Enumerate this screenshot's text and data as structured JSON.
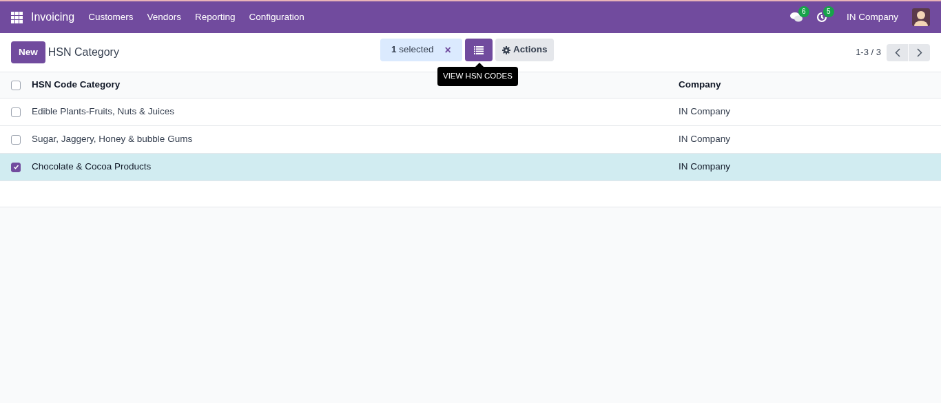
{
  "navbar": {
    "app_name": "Invoicing",
    "menu": [
      "Customers",
      "Vendors",
      "Reporting",
      "Configuration"
    ],
    "messages_count": "6",
    "activities_count": "5",
    "company": "IN Company"
  },
  "control_panel": {
    "new_button": "New",
    "title": "HSN Category",
    "selection": "**1** selected",
    "clear": "×",
    "tooltip": "VIEW HSN CODES",
    "actions": "Actions",
    "pager": "1-3 / 3"
  },
  "table": {
    "columns": [
      "HSN Code Category",
      "Company"
    ],
    "all_checked": false,
    "rows": [
      {
        "category": "Edible Plants-Fruits, Nuts & Juices",
        "company": "IN Company",
        "selected": false
      },
      {
        "category": "Sugar, Jaggery, Honey & bubble Gums",
        "company": "IN Company",
        "selected": false
      },
      {
        "category": "Chocolate & Cocoa Products",
        "company": "IN Company",
        "selected": true
      }
    ]
  }
}
